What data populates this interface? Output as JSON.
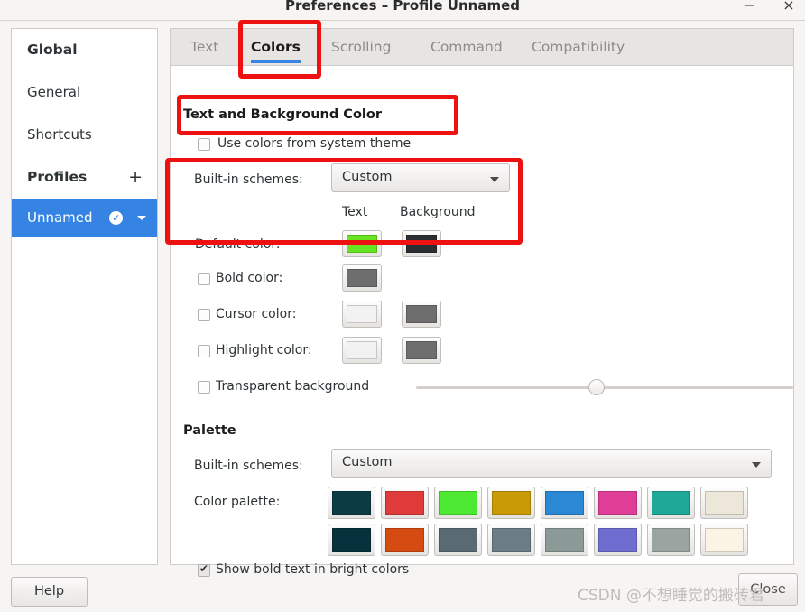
{
  "window": {
    "title": "Preferences – Profile  Unnamed",
    "minimize_label": "−",
    "close_label": "×"
  },
  "sidebar": {
    "items": [
      {
        "label": "Global",
        "type": "header"
      },
      {
        "label": "General",
        "type": "item"
      },
      {
        "label": "Shortcuts",
        "type": "item"
      },
      {
        "label": "Profiles",
        "type": "header",
        "add_label": "+"
      },
      {
        "label": "Unnamed",
        "type": "profile",
        "selected": true,
        "default_icon": "check-circle-icon",
        "menu_icon": "chevron-down-icon"
      }
    ]
  },
  "tabs": [
    {
      "label": "Text",
      "active": false
    },
    {
      "label": "Colors",
      "active": true
    },
    {
      "label": "Scrolling",
      "active": false
    },
    {
      "label": "Command",
      "active": false
    },
    {
      "label": "Compatibility",
      "active": false
    }
  ],
  "text_background": {
    "section_title": "Text and Background Color",
    "use_system_theme": {
      "label": "Use colors from system theme",
      "checked": false
    },
    "builtin_schemes": {
      "label": "Built-in schemes:",
      "value": "Custom"
    },
    "column_headers": {
      "text": "Text",
      "background": "Background"
    },
    "rows": [
      {
        "label": "Default color:",
        "checkbox": false,
        "text_color": "#68e522",
        "background_color": "#2b2f33"
      },
      {
        "label": "Bold color:",
        "checkbox": true,
        "checked": false,
        "text_color": "#6e6e6e",
        "background_color": null
      },
      {
        "label": "Cursor color:",
        "checkbox": true,
        "checked": false,
        "text_color": "#f2f2f2",
        "background_color": "#6e6e6e"
      },
      {
        "label": "Highlight color:",
        "checkbox": true,
        "checked": false,
        "text_color": "#f2f2f2",
        "background_color": "#6e6e6e"
      }
    ],
    "transparent_background": {
      "label": "Transparent background",
      "checked": false,
      "slider_value": 50
    }
  },
  "palette": {
    "section_title": "Palette",
    "builtin_schemes": {
      "label": "Built-in schemes:",
      "value": "Custom"
    },
    "color_palette_label": "Color palette:",
    "colors_row1": [
      "#0c3b44",
      "#e03b3b",
      "#4ce832",
      "#c99a03",
      "#2a88d4",
      "#df3d96",
      "#1ea897",
      "#ece7d8"
    ],
    "colors_row2": [
      "#05323c",
      "#d64b12",
      "#5a6a72",
      "#6c7d85",
      "#8b9a96",
      "#6f6ed0",
      "#9aa5a2",
      "#fbf3e3"
    ],
    "show_bold_bright": {
      "label": "Show bold text in bright colors",
      "checked": true
    }
  },
  "footer": {
    "help_label": "Help",
    "close_label": "Close",
    "watermark": "CSDN @不想睡觉的搬砖君"
  },
  "annotations": {
    "accent_color": "#ee1111",
    "boxes": [
      "colors-tab",
      "use-system-theme-row",
      "default-color-row"
    ]
  }
}
